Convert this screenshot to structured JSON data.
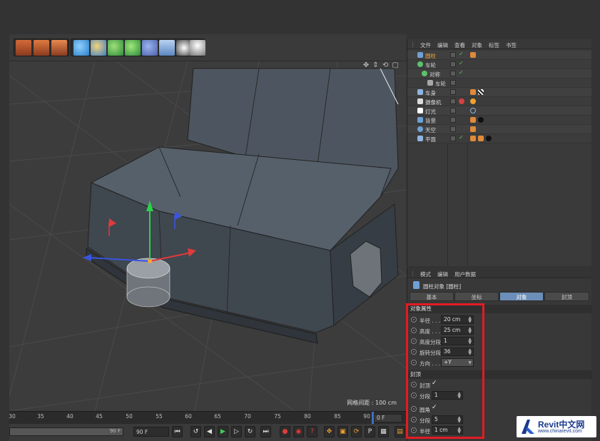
{
  "toolbar": {
    "icons": [
      "render-view-icon",
      "render-picture-viewer-icon",
      "render-settings-icon",
      "cube-icon",
      "pen-icon",
      "subdivision-icon",
      "cloner-icon",
      "deformer-icon",
      "floor-icon",
      "camera-icon",
      "light-icon"
    ]
  },
  "viewport": {
    "nav_icons": "✥ ⇕ ⟲ ▢",
    "grid_readout": "网格间距 : 100 cm"
  },
  "timeline": {
    "ticks": [
      "30",
      "35",
      "40",
      "45",
      "50",
      "55",
      "60",
      "65",
      "70",
      "75",
      "80",
      "85",
      "90"
    ],
    "current_frame": "0 F"
  },
  "playback": {
    "range_end_label": "90 F",
    "end_frame": "90 F"
  },
  "object_manager": {
    "menu": [
      "文件",
      "编辑",
      "查看",
      "对象",
      "标签",
      "书签"
    ],
    "objects": [
      {
        "name": "圆柱",
        "selected": true
      },
      {
        "name": "车轮"
      },
      {
        "name": "对称"
      },
      {
        "name": "车轮"
      },
      {
        "name": "车身"
      },
      {
        "name": "摄像机"
      },
      {
        "name": "灯光"
      },
      {
        "name": "背景"
      },
      {
        "name": "天空"
      },
      {
        "name": "平面"
      }
    ]
  },
  "attribute_manager": {
    "menu": [
      "模式",
      "编辑",
      "用户数据"
    ],
    "title": "圆柱对象 [圆柱]",
    "tabs": [
      "基本",
      "坐标",
      "对象",
      "封顶"
    ],
    "active_tab": "对象",
    "object_section": "对象属性",
    "props": {
      "radius": {
        "label": "半径 . . .",
        "value": "20 cm"
      },
      "height": {
        "label": "高度 . . .",
        "value": "25 cm"
      },
      "height_segments": {
        "label": "高度分段",
        "value": "1"
      },
      "rotation_segments": {
        "label": "旋转分段",
        "value": "36"
      },
      "orientation": {
        "label": "方向 . . .",
        "value": "+Y"
      }
    },
    "caps_section": "封顶",
    "caps": {
      "caps": {
        "label": "封顶",
        "checked": "✓"
      },
      "segments": {
        "label": "分段",
        "value": "1"
      },
      "fillet": {
        "label": "圆角",
        "checked": "✓"
      },
      "fillet_segments": {
        "label": "分段",
        "value": "5"
      },
      "fillet_radius": {
        "label": "半径",
        "value": "1 cm"
      }
    }
  },
  "watermark": {
    "main": "Revit中文网",
    "sub": "www.chinarevit.com"
  },
  "colors": {
    "highlight": "#e31b23",
    "active_tab": "#6b8fb8",
    "check": "#63c16b"
  }
}
